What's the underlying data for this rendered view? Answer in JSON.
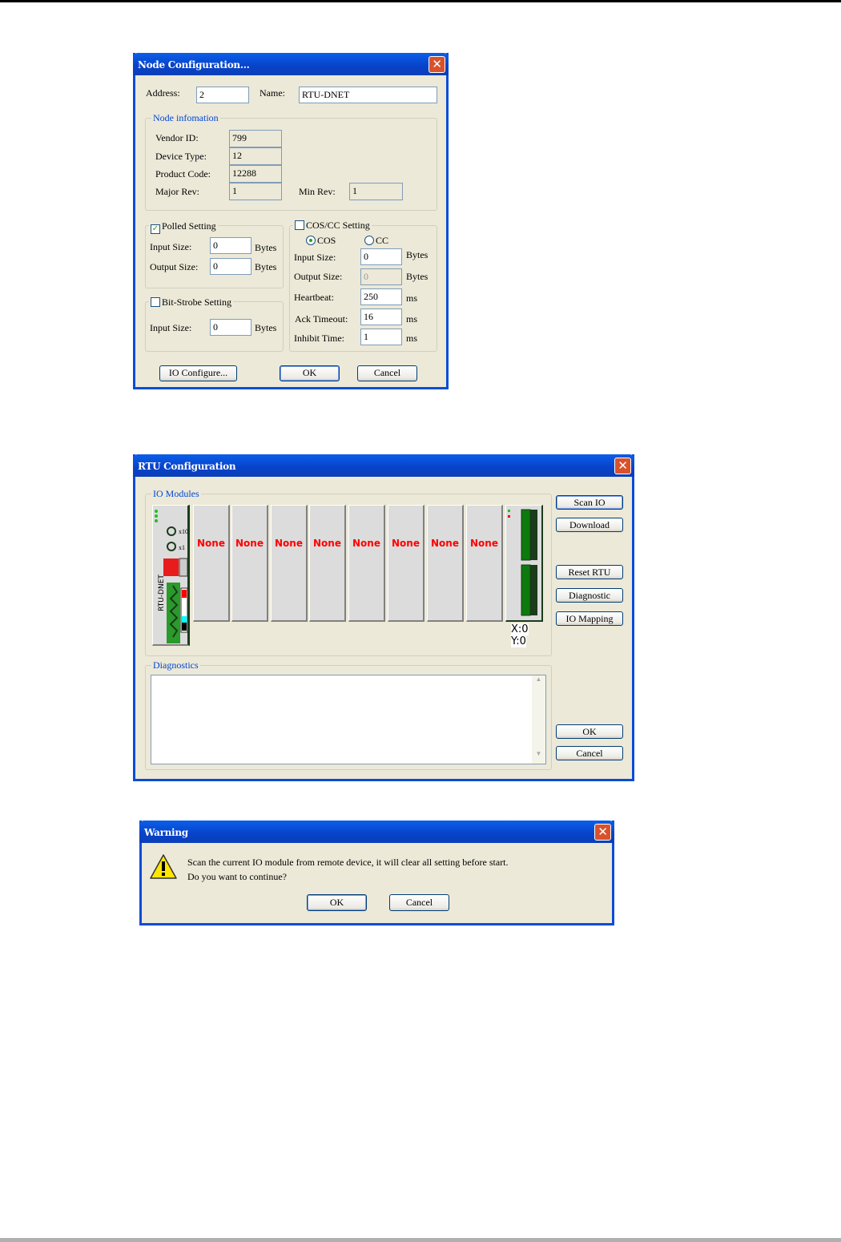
{
  "node_dialog": {
    "title": "Node Configuration...",
    "address_label": "Address:",
    "address": "2",
    "name_label": "Name:",
    "name": "RTU-DNET",
    "info_group": "Node infomation",
    "vendor_label": "Vendor ID:",
    "vendor": "799",
    "device_label": "Device Type:",
    "device": "12",
    "product_label": "Product Code:",
    "product": "12288",
    "major_label": "Major Rev:",
    "major": "1",
    "min_label": "Min Rev:",
    "min": "1",
    "polled": {
      "label": "Polled Setting",
      "checked": true,
      "input_label": "Input Size:",
      "input": "0",
      "output_label": "Output Size:",
      "output": "0",
      "unit": "Bytes"
    },
    "bitstrobe": {
      "label": "Bit-Strobe Setting",
      "checked": false,
      "input_label": "Input Size:",
      "input": "0",
      "unit": "Bytes"
    },
    "cos": {
      "label": "COS/CC Setting",
      "checked": false,
      "radio_cos": "COS",
      "radio_cc": "CC",
      "selected": "COS",
      "input_label": "Input Size:",
      "input": "0",
      "output_label": "Output Size:",
      "output": "0",
      "bytes": "Bytes",
      "heartbeat_label": "Heartbeat:",
      "heartbeat": "250",
      "ack_label": "Ack Timeout:",
      "ack": "16",
      "inhibit_label": "Inhibit Time:",
      "inhibit": "1",
      "ms": "ms"
    },
    "io_configure": "IO Configure...",
    "ok": "OK",
    "cancel": "Cancel"
  },
  "rtu_dialog": {
    "title": "RTU Configuration",
    "io_group": "IO Modules",
    "head_module": "RTU-DNET",
    "slots": [
      "None",
      "None",
      "None",
      "None",
      "None",
      "None",
      "None",
      "None"
    ],
    "x_readout": "X:0",
    "y_readout": "Y:0",
    "scan": "Scan IO",
    "download": "Download",
    "reset": "Reset RTU",
    "diagnostic": "Diagnostic",
    "mapping": "IO Mapping",
    "diag_group": "Diagnostics",
    "diag_text": "",
    "ok": "OK",
    "cancel": "Cancel"
  },
  "warning": {
    "title": "Warning",
    "line1": "Scan the current IO module from remote device, it will clear all setting before start.",
    "line2": "Do you want to continue?",
    "ok": "OK",
    "cancel": "Cancel"
  },
  "close_symbol": "✕"
}
